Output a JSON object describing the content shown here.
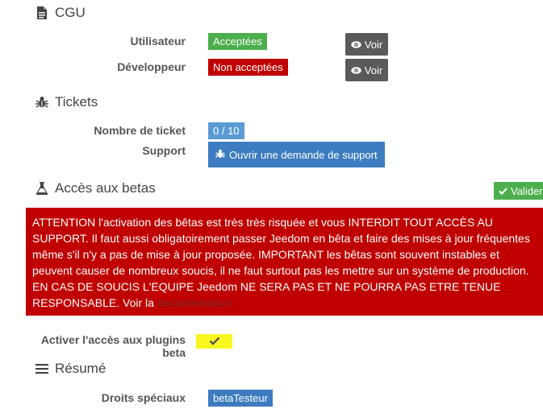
{
  "cgu": {
    "title": "CGU",
    "user_label": "Utilisateur",
    "user_status": "Acceptées",
    "dev_label": "Développeur",
    "dev_status": "Non acceptées",
    "voir_label": "Voir",
    "accepted_color": "#4cae4c",
    "refused_color": "#c00000"
  },
  "tickets": {
    "title": "Tickets",
    "count_label": "Nombre de ticket",
    "count_value": "0 / 10",
    "support_label": "Support",
    "support_button": "Ouvrir une demande de support",
    "count_color": "#5b9bd5"
  },
  "betas": {
    "title": "Accès aux betas",
    "validate_button": "Valider",
    "warning_text": "ATTENTION l'activation des bêtas est très très risquée et vous INTERDIT TOUT ACCÈS AU SUPPORT. Il faut aussi obligatoirement passer Jeedom en bêta et faire des mises à jour fréquentes même s'il n'y a pas de mise à jour proposée. IMPORTANT les bêtas sont souvent instables et peuvent causer de nombreux soucis, il ne faut surtout pas les mettre sur un système de production. EN CAS DE SOUCIS L'EQUIPE Jeedom NE SERA PAS ET NE POURRA PAS ETRE TENUE RESPONSABLE. Voir la",
    "doc_link": "documentation",
    "plugins_label": "Activer l'accès aux plugins beta",
    "plugins_checked": true,
    "alert_color": "#c00000"
  },
  "resume": {
    "title": "Résumé",
    "rights_label": "Droits spéciaux",
    "rights_value": "betaTesteur"
  },
  "icons": {
    "cgu": "file-icon",
    "tickets": "bug-icon",
    "betas": "flask-icon",
    "resume": "bars-icon",
    "voir": "eye-icon",
    "valider": "check-icon"
  }
}
